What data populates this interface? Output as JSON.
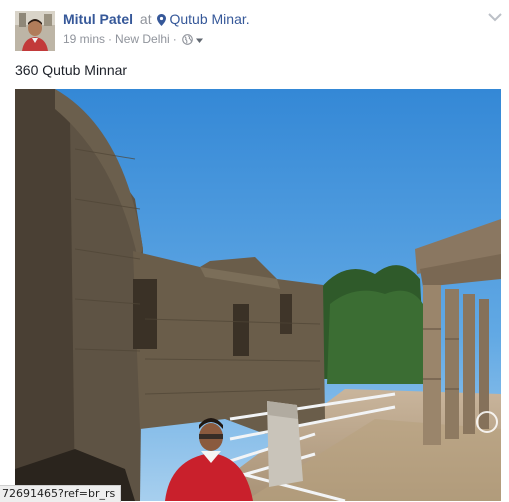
{
  "post": {
    "author": "Mitul Patel",
    "at_word": "at",
    "location": "Qutub Minar.",
    "time": "19 mins",
    "separator": "·",
    "place": "New Delhi",
    "text": "360 Qutub Minnar",
    "avatar_icon": "profile-photo",
    "location_icon": "map-pin-icon",
    "audience_icon": "globe-icon",
    "audience_menu_icon": "caret-down-icon",
    "options_icon": "chevron-down-icon"
  },
  "photo": {
    "kind": "360-photo",
    "nav_icon": "360-navigation-icon"
  },
  "status_bar": {
    "url": "72691465?ref=br_rs"
  },
  "colors": {
    "link": "#365899",
    "meta": "#90949c",
    "text": "#1d2129"
  }
}
